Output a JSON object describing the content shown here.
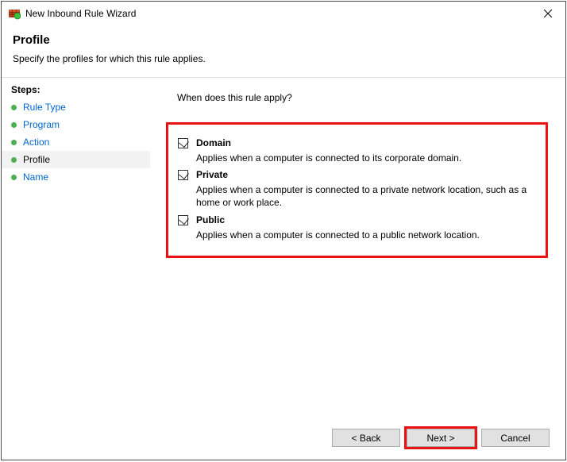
{
  "titlebar": {
    "title": "New Inbound Rule Wizard"
  },
  "header": {
    "title": "Profile",
    "subtitle": "Specify the profiles for which this rule applies."
  },
  "sidebar": {
    "heading": "Steps:",
    "items": [
      {
        "label": "Rule Type"
      },
      {
        "label": "Program"
      },
      {
        "label": "Action"
      },
      {
        "label": "Profile"
      },
      {
        "label": "Name"
      }
    ]
  },
  "content": {
    "prompt": "When does this rule apply?",
    "profiles": [
      {
        "label": "Domain",
        "desc": "Applies when a computer is connected to its corporate domain."
      },
      {
        "label": "Private",
        "desc": "Applies when a computer is connected to a private network location, such as a home or work place."
      },
      {
        "label": "Public",
        "desc": "Applies when a computer is connected to a public network location."
      }
    ]
  },
  "buttons": {
    "back": "< Back",
    "next": "Next >",
    "cancel": "Cancel"
  }
}
